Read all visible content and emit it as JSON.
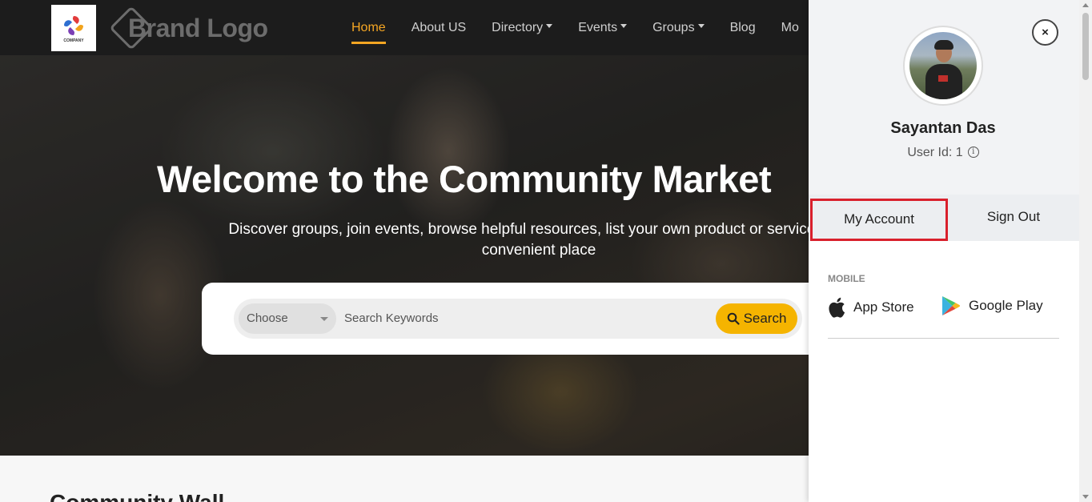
{
  "nav": {
    "company_logo_text": "COMPANY",
    "brand_text": "Brand Logo",
    "links": [
      {
        "label": "Home",
        "active": true
      },
      {
        "label": "About US"
      },
      {
        "label": "Directory",
        "dropdown": true
      },
      {
        "label": "Events",
        "dropdown": true
      },
      {
        "label": "Groups",
        "dropdown": true
      },
      {
        "label": "Blog"
      },
      {
        "label": "Mo"
      }
    ]
  },
  "hero": {
    "title": "Welcome to the Community Market",
    "subtitle": "Discover groups, join events, browse helpful resources, list your own product or service, and",
    "subtitle_line2": "convenient place",
    "search": {
      "choose_label": "Choose",
      "keywords_placeholder": "Search Keywords",
      "button_label": "Search"
    }
  },
  "below_section_title": "Community Wall",
  "drawer": {
    "user_name": "Sayantan Das",
    "user_id": "User Id: 1",
    "close_symbol": "×",
    "tabs": {
      "my_account": "My Account",
      "sign_out": "Sign Out"
    },
    "mobile_label": "MOBILE",
    "app_store": "App Store",
    "google_play": "Google Play"
  },
  "colors": {
    "accent": "#f5a623",
    "search_button": "#f5b400",
    "highlight_border": "#d9202c",
    "navbar_bg": "#1c1c1c"
  }
}
